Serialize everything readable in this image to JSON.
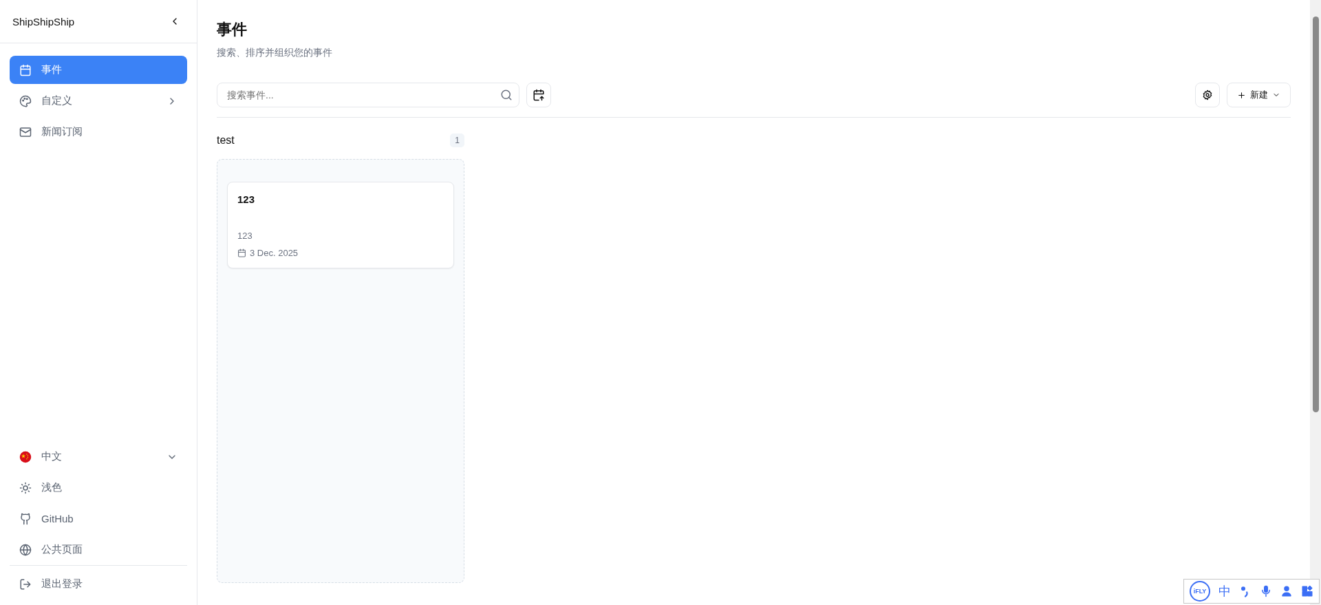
{
  "sidebar": {
    "brand": "ShipShipShip",
    "nav": [
      {
        "label": "事件",
        "kind": "calendar",
        "selected": true,
        "chevron": false
      },
      {
        "label": "自定义",
        "kind": "palette",
        "selected": false,
        "chevron": true
      },
      {
        "label": "新闻订阅",
        "kind": "mail",
        "selected": false,
        "chevron": false
      }
    ],
    "footer": [
      {
        "label": "中文",
        "kind": "flag",
        "dropdown": true
      },
      {
        "label": "浅色",
        "kind": "sun",
        "dropdown": false
      },
      {
        "label": "GitHub",
        "kind": "github",
        "dropdown": false
      },
      {
        "label": "公共页面",
        "kind": "globe",
        "dropdown": false
      }
    ],
    "logout": "退出登录"
  },
  "page": {
    "title": "事件",
    "subtitle": "搜索、排序并组织您的事件"
  },
  "toolbar": {
    "search": {
      "placeholder": "搜索事件..."
    },
    "new_button": "新建"
  },
  "columns": [
    {
      "title": "test",
      "count": "1",
      "cards": [
        {
          "title": "123",
          "description": "123",
          "date": "3 Dec. 2025"
        }
      ]
    }
  ],
  "ime_toolbar": {
    "logo": "iFLY",
    "mode": "中"
  }
}
